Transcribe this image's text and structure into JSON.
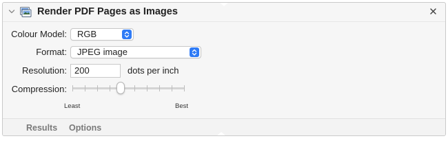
{
  "header": {
    "title": "Render PDF Pages as Images",
    "icon": "app-icon",
    "close_icon": "close-icon",
    "collapse_icon": "chevron-down-icon"
  },
  "form": {
    "colour_model": {
      "label": "Colour Model:",
      "value": "RGB"
    },
    "format": {
      "label": "Format:",
      "value": "JPEG image"
    },
    "resolution": {
      "label": "Resolution:",
      "value": "200",
      "unit": "dots per inch"
    },
    "compression": {
      "label": "Compression:",
      "min_label": "Least",
      "max_label": "Best",
      "tick_count": 10,
      "level": 0.43
    }
  },
  "footer": {
    "tabs": [
      {
        "label": "Results"
      },
      {
        "label": "Options"
      }
    ]
  },
  "colors": {
    "accent": "#2f7bf6",
    "panel": "#f6f6f6"
  }
}
